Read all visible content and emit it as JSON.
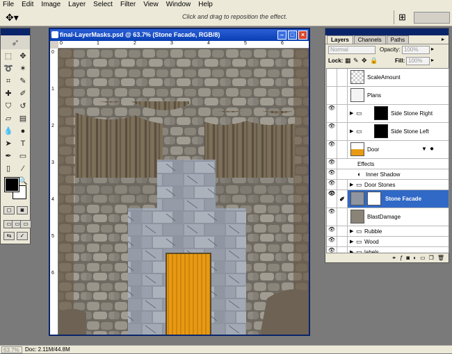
{
  "menu": [
    "File",
    "Edit",
    "Image",
    "Layer",
    "Select",
    "Filter",
    "View",
    "Window",
    "Help"
  ],
  "options_bar": {
    "hint": "Click and drag to reposition the effect."
  },
  "document": {
    "title": "final-LayerMasks.psd @ 63.7% (Stone Facade, RGB/8)",
    "ruler_top": [
      "0",
      "1",
      "2",
      "3",
      "4",
      "5",
      "6"
    ],
    "ruler_left": [
      "0",
      "1",
      "2",
      "3",
      "4",
      "5",
      "6"
    ]
  },
  "layers_panel": {
    "tabs": [
      "Layers",
      "Channels",
      "Paths"
    ],
    "blend_mode": "Normal",
    "opacity_label": "Opacity:",
    "opacity": "100%",
    "lock_label": "Lock:",
    "fill_label": "Fill:",
    "fill": "100%",
    "layers": [
      {
        "name": "ScaleAmount",
        "visible": false,
        "type": "layer"
      },
      {
        "name": "Plans",
        "visible": false,
        "type": "layer"
      },
      {
        "name": "Side Stone Right",
        "visible": true,
        "type": "group-mask"
      },
      {
        "name": "Side Stone Left",
        "visible": true,
        "type": "group-mask"
      },
      {
        "name": "Door",
        "visible": true,
        "type": "layer-fx"
      },
      {
        "name": "Effects",
        "visible": true,
        "type": "effects"
      },
      {
        "name": "Inner Shadow",
        "visible": true,
        "type": "effect"
      },
      {
        "name": "Door Stones",
        "visible": true,
        "type": "folder"
      },
      {
        "name": "Stone Facade",
        "visible": true,
        "type": "selected"
      },
      {
        "name": "BlastDamage",
        "visible": true,
        "type": "layer"
      },
      {
        "name": "Rubble",
        "visible": true,
        "type": "folder"
      },
      {
        "name": "Wood",
        "visible": true,
        "type": "folder"
      },
      {
        "name": "labels",
        "visible": true,
        "type": "folder"
      }
    ]
  },
  "status": {
    "zoom": "63.7%",
    "doc": "Doc: 2.11M/44.8M"
  },
  "colors": {
    "title_blue": "#0a3fb3",
    "selected_layer": "#3169c6",
    "door_orange": "#e79a12"
  }
}
